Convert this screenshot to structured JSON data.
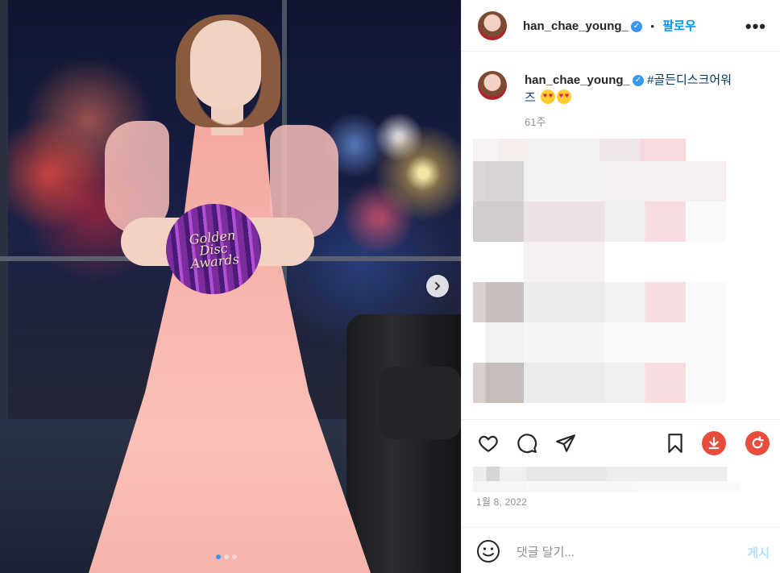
{
  "post": {
    "username": "han_chae_young_",
    "follow_label": "팔로우",
    "separator": "•",
    "more_label": "•••",
    "caption_hashtag_part1": "#골든디스크어워",
    "caption_hashtag_part2": "즈",
    "caption_emojis": [
      "smiling-face-with-heart-eyes",
      "smiling-face-with-heart-eyes"
    ],
    "time_ago": "61주",
    "date": "1월 8, 2022",
    "image_carousel": {
      "total": 3,
      "active_index": 0
    },
    "disc_text": [
      "Golden",
      "Disc",
      "Awards"
    ]
  },
  "comment": {
    "placeholder": "댓글 달기...",
    "post_label": "게시"
  },
  "colors": {
    "link": "#0095f6",
    "hashtag": "#00376b",
    "verified": "#3897f0",
    "extension": "#e74c3c"
  }
}
